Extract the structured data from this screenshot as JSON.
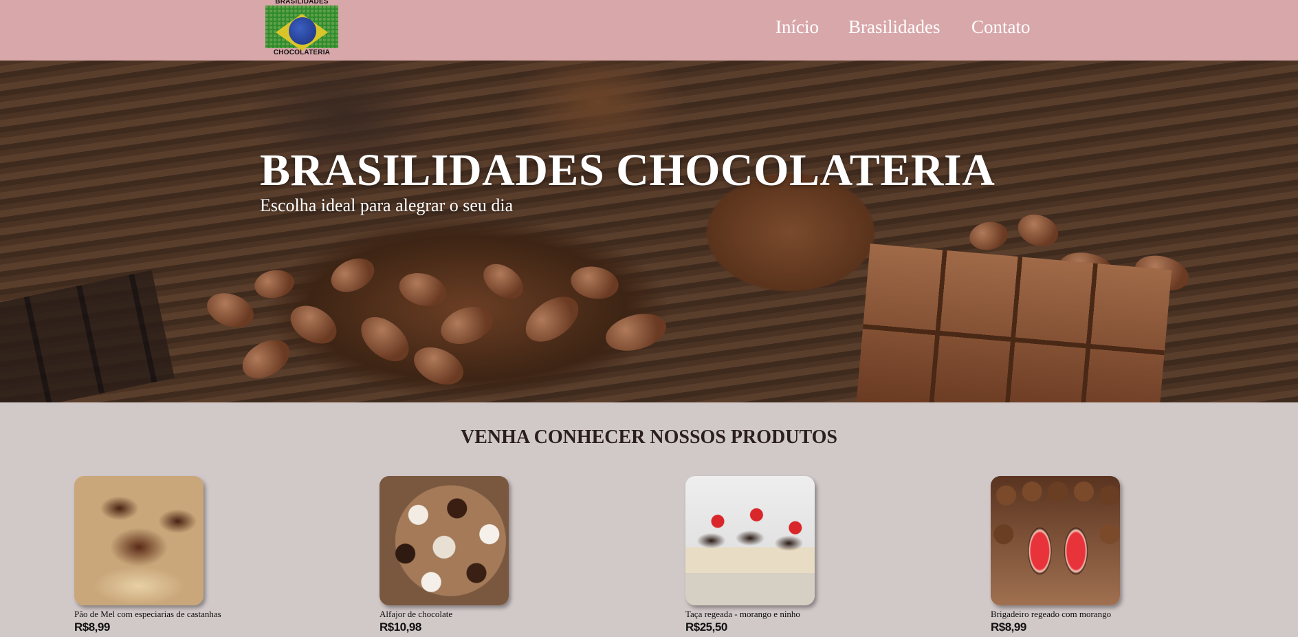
{
  "header": {
    "logo": {
      "top_text": "BRASILIDADES",
      "bottom_text": "CHOCOLATERIA"
    },
    "nav": [
      {
        "label": "Início"
      },
      {
        "label": "Brasilidades"
      },
      {
        "label": "Contato"
      }
    ],
    "background_color": "#d8a7aa"
  },
  "hero": {
    "title": "BRASILIDADES CHOCOLATERIA",
    "subtitle": "Escolha ideal para alegrar o seu dia"
  },
  "products_section": {
    "title": "VENHA CONHECER NOSSOS PRODUTOS",
    "products": [
      {
        "name": "Pão de Mel com especiarias de castanhas",
        "price": "R$8,99",
        "image": "pao-de-mel-image"
      },
      {
        "name": "Alfajor de chocolate",
        "price": "R$10,98",
        "image": "alfajor-image"
      },
      {
        "name": "Taça regeada - morango e ninho",
        "price": "R$25,50",
        "image": "taca-image"
      },
      {
        "name": "Brigadeiro regeado com morango",
        "price": "R$8,99",
        "image": "brigadeiro-image"
      }
    ]
  },
  "colors": {
    "page_background": "#d1c8c8",
    "header": "#d8a7aa",
    "text_light": "#ffffff",
    "text_dark": "#111111"
  }
}
